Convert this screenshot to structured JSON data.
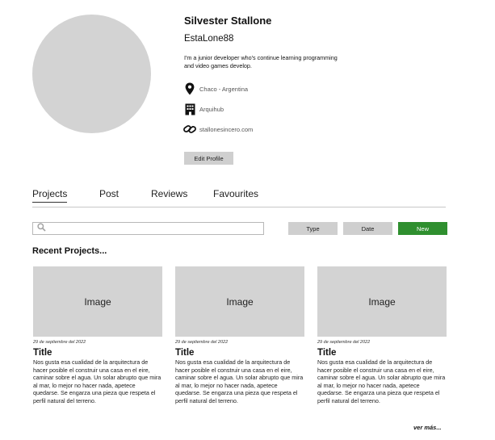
{
  "profile": {
    "name": "Silvester Stallone",
    "username": "EstaLone88",
    "bio": "I'm a junior developer who's continue learning programming and video games develop.",
    "location": "Chaco - Argentina",
    "organization": "Arquihub",
    "website": "stallonesincero.com",
    "edit_label": "Edit Profile",
    "icons": {
      "location": "map-pin-icon",
      "organization": "building-icon",
      "website": "link-icon"
    }
  },
  "tabs": [
    {
      "label": "Projects",
      "active": true
    },
    {
      "label": "Post",
      "active": false
    },
    {
      "label": "Reviews",
      "active": false
    },
    {
      "label": "Favourites",
      "active": false
    }
  ],
  "toolbar": {
    "search_placeholder": "",
    "search_icon": "search-icon",
    "type_label": "Type",
    "date_label": "Date",
    "new_label": "New",
    "colors": {
      "new": "#2f8f2f",
      "neutral": "#cfcfcf"
    }
  },
  "recent": {
    "heading": "Recent Projects...",
    "cards": [
      {
        "image_label": "Image",
        "date": "29 de septiembre del 2022",
        "title": "Title",
        "description": "Nos gusta esa cualidad de la arquitectura de hacer posible el construir una casa en el eire, caminar sobre el agua. Un solar abrupto que mira al mar, lo mejor no hacer nada, apetece quedarse. Se engarza una pieza que respeta el perfil natural del terreno."
      },
      {
        "image_label": "Image",
        "date": "29 de septiembre del 2022",
        "title": "Title",
        "description": "Nos gusta esa cualidad de la arquitectura de hacer posible el construir una casa en el eire, caminar sobre el agua. Un solar abrupto que mira al mar, lo mejor no hacer nada, apetece quedarse. Se engarza una pieza que respeta el perfil natural del terreno."
      },
      {
        "image_label": "Image",
        "date": "29 de septiembre del 2022",
        "title": "Title",
        "description": "Nos gusta esa cualidad de la arquitectura de hacer posible el construir una casa en el eire, caminar sobre el agua. Un solar abrupto que mira al mar, lo mejor no hacer nada, apetece quedarse. Se engarza una pieza que respeta el perfil natural del terreno."
      }
    ],
    "more_label": "ver más..."
  }
}
